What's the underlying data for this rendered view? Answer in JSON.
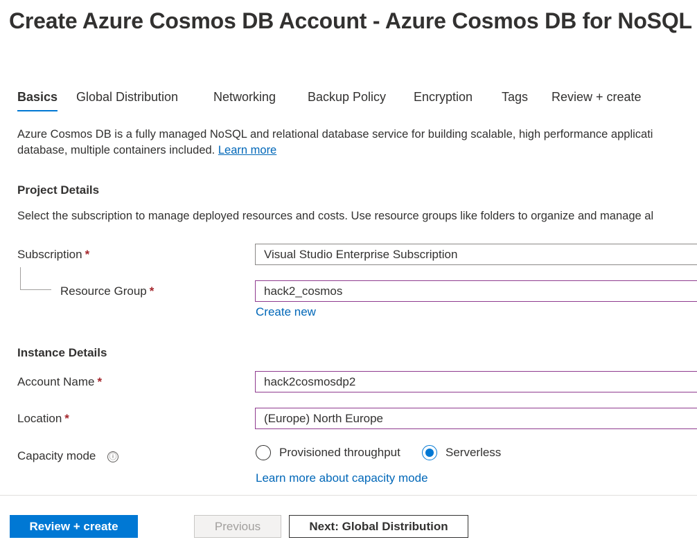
{
  "page_title": "Create Azure Cosmos DB Account - Azure Cosmos DB for NoSQL",
  "tabs": [
    {
      "label": "Basics",
      "active": true
    },
    {
      "label": "Global Distribution",
      "active": false
    },
    {
      "label": "Networking",
      "active": false
    },
    {
      "label": "Backup Policy",
      "active": false
    },
    {
      "label": "Encryption",
      "active": false
    },
    {
      "label": "Tags",
      "active": false
    },
    {
      "label": "Review + create",
      "active": false
    }
  ],
  "description": {
    "line1": "Azure Cosmos DB is a fully managed NoSQL and relational database service for building scalable, high performance applicati",
    "line2": "database, multiple containers included.",
    "learn_more": "Learn more"
  },
  "project_details": {
    "heading": "Project Details",
    "subtext": "Select the subscription to manage deployed resources and costs. Use resource groups like folders to organize and manage al",
    "subscription": {
      "label": "Subscription",
      "value": "Visual Studio Enterprise Subscription"
    },
    "resource_group": {
      "label": "Resource Group",
      "value": "hack2_cosmos",
      "create_new": "Create new"
    }
  },
  "instance_details": {
    "heading": "Instance Details",
    "account_name": {
      "label": "Account Name",
      "value": "hack2cosmosdp2"
    },
    "location": {
      "label": "Location",
      "value": "(Europe) North Europe"
    },
    "capacity_mode": {
      "label": "Capacity mode",
      "info_icon": "ⓘ",
      "options": [
        {
          "label": "Provisioned throughput",
          "selected": false
        },
        {
          "label": "Serverless",
          "selected": true
        }
      ],
      "learn_more": "Learn more about capacity mode"
    }
  },
  "required_marker": "*",
  "footer": {
    "review_create": "Review + create",
    "previous": "Previous",
    "next": "Next: Global Distribution"
  },
  "colors": {
    "accent": "#0078d4",
    "link": "#0067b8",
    "required": "#a4262c",
    "focus_border": "#8e3a8e"
  }
}
